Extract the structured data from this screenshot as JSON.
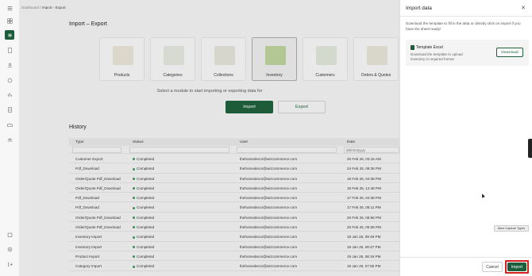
{
  "breadcrumb": {
    "root": "Dashboard",
    "separator": "/",
    "current": "Import - Export"
  },
  "page": {
    "title": "Import – Export",
    "prompt": "Select a module to start importing or exporting data for"
  },
  "modules": [
    {
      "label": "Products",
      "icon": "products-illustration"
    },
    {
      "label": "Categories",
      "icon": "categories-illustration"
    },
    {
      "label": "Collections",
      "icon": "collections-illustration"
    },
    {
      "label": "Inventory",
      "icon": "inventory-illustration",
      "selected": true
    },
    {
      "label": "Customers",
      "icon": "customers-illustration"
    },
    {
      "label": "Orders & Quotes",
      "icon": "orders-illustration"
    }
  ],
  "actions": {
    "import": "Import",
    "export": "Export"
  },
  "history": {
    "title": "History",
    "columns": [
      "Type",
      "Status",
      "User",
      "Date"
    ],
    "date_filter_placeholder": "dd/mm/yyyy",
    "rows": [
      {
        "type": "Customer Export",
        "status": "Completed",
        "user": "thehomedecor@wizcommerce.com",
        "date": "26 Feb 26, 03:16 AM"
      },
      {
        "type": "Pdf_Download",
        "status": "Completed",
        "user": "thehomedecor@wizcommerce.com",
        "date": "24 Feb 26, 09:36 PM"
      },
      {
        "type": "Order/Quote Pdf_Download",
        "status": "Completed",
        "user": "thehomedecor@wizcommerce.com",
        "date": "19 Feb 26, 04:38 PM"
      },
      {
        "type": "Order/Quote Pdf_Download",
        "status": "Completed",
        "user": "thehomedecor@wizcommerce.com",
        "date": "18 Feb 26, 12:48 PM"
      },
      {
        "type": "Pdf_Download",
        "status": "Completed",
        "user": "thehomedecor@wizcommerce.com",
        "date": "17 Feb 26, 04:38 PM"
      },
      {
        "type": "Pdf_Download",
        "status": "Completed",
        "user": "thehomedecor@wizcommerce.com",
        "date": "17 Feb 26, 08:11 PM"
      },
      {
        "type": "Order/Quote Pdf_Download",
        "status": "Completed",
        "user": "thehomedecor@wizcommerce.com",
        "date": "20 Feb 26, 05:56 PM"
      },
      {
        "type": "Order/Quote Pdf_Download",
        "status": "Completed",
        "user": "thehomedecor@wizcommerce.com",
        "date": "20 Feb 26, 05:56 PM"
      },
      {
        "type": "Inventory Import",
        "status": "Completed",
        "user": "thehomedecor@wizcommerce.com",
        "date": "19 Jan 26, 09:49 PM"
      },
      {
        "type": "Inventory Import",
        "status": "Completed",
        "user": "thehomedecor@wizcommerce.com",
        "date": "19 Jan 26, 08:47 PM"
      },
      {
        "type": "Product Import",
        "status": "Completed",
        "user": "thehomedecor@wizcommerce.com",
        "date": "19 Jan 26, 08:19 PM"
      },
      {
        "type": "Category Import",
        "status": "Completed",
        "user": "thehomedecor@wizcommerce.com",
        "date": "19 Jan 26, 07:55 PM"
      }
    ]
  },
  "panel": {
    "title": "Import data",
    "description": "Download the template to fill in the data or directly click on import if you have the sheet ready!",
    "template_title": "Template Excel",
    "template_desc": "Download the template to upload inventory in required format",
    "download": "Download",
    "cancel": "Cancel",
    "import": "Import"
  },
  "tooltip": "More Capture Types",
  "colors": {
    "brand": "#1d5e3a",
    "status_ok": "#2e9b55",
    "highlight": "#d41f1f"
  }
}
